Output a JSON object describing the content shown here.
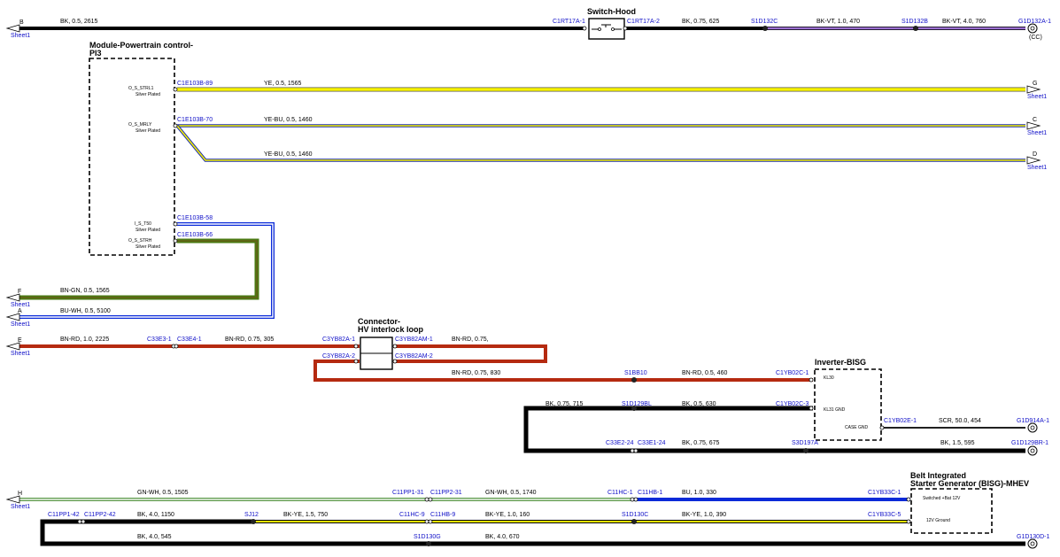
{
  "modules": {
    "pcm_title": "Module-Powertrain control-",
    "pcm_title2": "PI3",
    "switch_hood": "Switch-Hood",
    "connector_title": "Connector-",
    "connector_title2": "HV interlock loop",
    "inverter": "Inverter-BISG",
    "bisg_title": "Belt Integrated",
    "bisg_title2": "Starter Generator (BISG)-MHEV"
  },
  "pins": {
    "strl1": "O_S_STRL1",
    "mrly": "O_S_MRLY",
    "t50": "I_S_T50",
    "strh": "O_S_STRH",
    "silver": "Silver Plated",
    "kl30": "KL30",
    "kl31": "KL31 GND",
    "case": "CASE GND",
    "bat12": "Switched +Bat 12V",
    "gnd12": "12V Ground"
  },
  "offpage": {
    "sheet": "Sheet1",
    "B": "B",
    "G": "G",
    "C": "C",
    "D": "D",
    "F": "F",
    "A": "A",
    "E": "E",
    "H": "H",
    "cc": "(CC)"
  },
  "connectors": {
    "c1rt17a1": "C1RT17A-1",
    "c1rt17a2": "C1RT17A-2",
    "s1d132c": "S1D132C",
    "s1d132b": "S1D132B",
    "g1d132a1": "G1D132A-1",
    "c1e103b89": "C1E103B-89",
    "c1e103b70": "C1E103B-70",
    "c1e103b58": "C1E103B-58",
    "c1e103b66": "C1E103B-66",
    "c33e31": "C33E3-1",
    "c33e41": "C33E4-1",
    "c3yb82a1": "C3YB82A-1",
    "c3yb82am1": "C3YB82AM-1",
    "c3yb82a2": "C3YB82A-2",
    "c3yb82am2": "C3YB82AM-2",
    "s1bb10": "S1BB10",
    "c1yb02c1": "C1YB02C-1",
    "s1d129bl": "S1D129BL",
    "c1yb02c3": "C1YB02C-3",
    "c1yb02e1": "C1YB02E-1",
    "g1d914a1": "G1D914A-1",
    "c33e224": "C33E2-24",
    "c33e124": "C33E1-24",
    "s3d197a": "S3D197A",
    "g1d129br1": "G1D129BR-1",
    "c11pp131": "C11PP1-31",
    "c11pp231": "C11PP2-31",
    "c11hc1": "C11HC-1",
    "c11hb1": "C11HB-1",
    "c1yb33c1": "C1YB33C-1",
    "c11pp142": "C11PP1-42",
    "c11pp242": "C11PP2-42",
    "sj12": "SJ12",
    "c11hc9": "C11HC-9",
    "c11hb9": "C11HB-9",
    "s1d130c": "S1D130C",
    "c1yb33c5": "C1YB33C-5",
    "s1d130g": "S1D130G",
    "g1d130d1": "G1D130D-1"
  },
  "wires": {
    "w_b": "BK, 0.5, 2615",
    "w_b2": "BK, 0.75, 625",
    "w_b3": "BK-VT, 1.0, 470",
    "w_b4": "BK-VT, 4.0, 760",
    "w_g": "YE, 0.5, 1565",
    "w_c": "YE-BU, 0.5, 1460",
    "w_d": "YE-BU, 0.5, 1460",
    "w_f": "BN-GN, 0.5, 1565",
    "w_a": "BU-WH, 0.5, 5100",
    "w_e1": "BN-RD, 1.0, 2225",
    "w_e2": "BN-RD, 0.75, 305",
    "w_e3": "BN-RD, 0.75,",
    "w_e4": "BN-RD, 0.75, 830",
    "w_e5": "BN-RD, 0.5, 460",
    "w_k1": "BK, 0.75, 715",
    "w_k2": "BK, 0.5, 630",
    "w_k3": "SCR, 50.0, 454",
    "w_k4": "BK, 0.75, 675",
    "w_k5": "BK, 1.5, 595",
    "w_h1": "GN-WH, 0.5, 1505",
    "w_h2": "GN-WH, 0.5, 1740",
    "w_h3": "BU, 1.0, 330",
    "w_p1": "BK, 4.0, 1150",
    "w_p2": "BK-YE, 1.5, 750",
    "w_p3": "BK-YE, 1.0, 160",
    "w_p4": "BK-YE, 1.0, 390",
    "w_p5": "BK, 4.0, 545",
    "w_p6": "BK, 4.0, 670"
  },
  "colors": {
    "black": "#000000",
    "violet": "#9b6fd1",
    "yellow": "#f7f200",
    "bluestripe": "#1d2fae",
    "green": "#4a7a12",
    "red": "#b52a10",
    "lightgreen": "#8dcf6e",
    "blue": "#0a2ad8"
  }
}
